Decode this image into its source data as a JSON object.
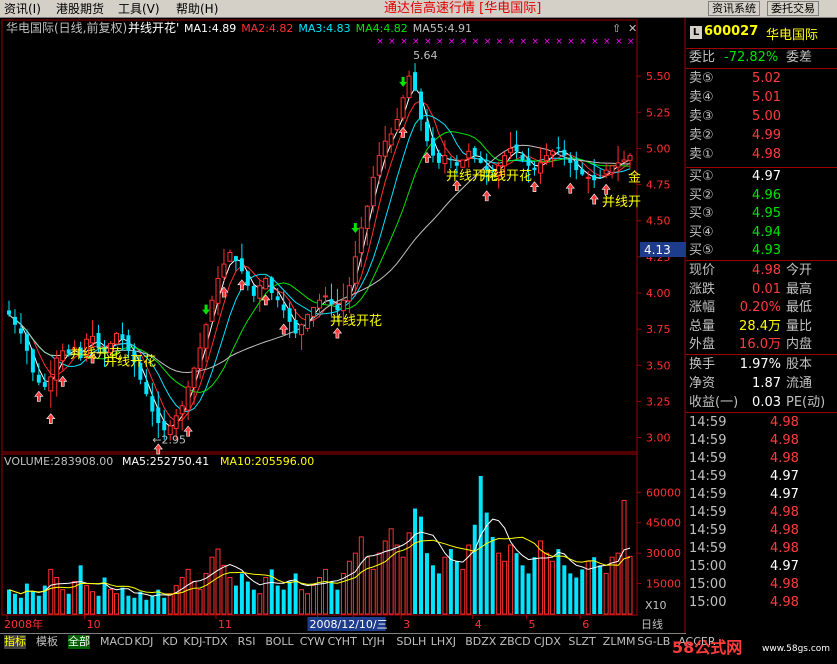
{
  "menu": {
    "items": [
      "资讯(I)",
      "港股期货",
      "工具(V)",
      "帮助(H)"
    ],
    "center_title": "通达信高速行情 [华电国际]",
    "buttons": [
      "资讯系统",
      "委托交易"
    ]
  },
  "header": {
    "stock_name": "华电国际(日线,前复权)",
    "indicator_name": "并线开花'",
    "ma_labels": [
      {
        "text": "MA1:4.89",
        "color": "#ffffff"
      },
      {
        "text": "MA2:4.82",
        "color": "#ff3030"
      },
      {
        "text": "MA3:4.83",
        "color": "#00e5ff"
      },
      {
        "text": "MA4:4.82",
        "color": "#00e400"
      },
      {
        "text": "MA55:4.91",
        "color": "#c0c0c0"
      }
    ]
  },
  "chart_data": [
    {
      "type": "candlestick",
      "title": "华电国际(日线,前复权)",
      "y_ticks": [
        5.5,
        5.25,
        5.0,
        4.75,
        4.5,
        4.25,
        4.0,
        3.75,
        3.5,
        3.25,
        3.0
      ],
      "ylim": [
        2.9,
        5.75
      ],
      "x_labels": [
        "2008年",
        "10",
        "11",
        "12",
        "2",
        "3",
        "4",
        "5",
        "6"
      ],
      "current_price_marker": "4.13",
      "annotations": [
        "5.64",
        "←2.95",
        "并线开花",
        "并线开花",
        "并线开花",
        "并线开花",
        "并线开花",
        "并线开",
        "金"
      ],
      "close_series": [
        3.85,
        3.78,
        3.72,
        3.6,
        3.45,
        3.38,
        3.35,
        3.42,
        3.55,
        3.6,
        3.58,
        3.62,
        3.55,
        3.68,
        3.7,
        3.62,
        3.58,
        3.65,
        3.72,
        3.68,
        3.6,
        3.52,
        3.4,
        3.3,
        3.18,
        3.1,
        3.05,
        3.08,
        3.15,
        3.22,
        3.35,
        3.48,
        3.62,
        3.78,
        3.95,
        4.1,
        4.2,
        4.28,
        4.22,
        4.15,
        4.05,
        3.98,
        4.05,
        4.1,
        4.0,
        3.95,
        3.88,
        3.8,
        3.72,
        3.78,
        3.85,
        3.9,
        3.95,
        3.98,
        3.92,
        3.88,
        3.95,
        4.05,
        4.25,
        4.45,
        4.6,
        4.8,
        4.95,
        5.05,
        5.1,
        5.2,
        5.35,
        5.5,
        5.4,
        5.2,
        5.05,
        4.95,
        4.9,
        4.95,
        4.92,
        4.88,
        4.92,
        4.98,
        4.95,
        4.9,
        4.85,
        4.82,
        4.88,
        4.95,
        5.0,
        4.98,
        4.92,
        4.88,
        4.85,
        4.9,
        4.95,
        4.98,
        5.0,
        4.95,
        4.9,
        4.85,
        4.82,
        4.8,
        4.78,
        4.8,
        4.85,
        4.88,
        4.9,
        4.92,
        4.95
      ]
    },
    {
      "type": "bar",
      "title": "VOLUME",
      "series": [
        {
          "name": "VOLUME:283908.00",
          "color": "#c0c0c0"
        },
        {
          "name": "MA5:252750.41",
          "color": "#ffffff"
        },
        {
          "name": "MA10:205596.00",
          "color": "#ffff00"
        }
      ],
      "y_ticks": [
        60000,
        45000,
        30000,
        15000
      ],
      "ylim": [
        0,
        70000
      ],
      "unit_label": "X10",
      "values": [
        12000,
        10000,
        8000,
        15000,
        11000,
        9000,
        14000,
        22000,
        18000,
        12000,
        10000,
        16000,
        24000,
        14000,
        11000,
        9000,
        18000,
        12000,
        10000,
        13000,
        9000,
        8000,
        11000,
        7000,
        9000,
        12000,
        8000,
        10000,
        14000,
        18000,
        22000,
        16000,
        12000,
        20000,
        28000,
        32000,
        24000,
        18000,
        14000,
        20000,
        16000,
        12000,
        10000,
        18000,
        22000,
        14000,
        12000,
        16000,
        20000,
        12000,
        10000,
        14000,
        18000,
        22000,
        16000,
        12000,
        20000,
        26000,
        30000,
        38000,
        28000,
        22000,
        30000,
        36000,
        42000,
        34000,
        28000,
        40000,
        52000,
        48000,
        30000,
        24000,
        20000,
        28000,
        32000,
        26000,
        22000,
        34000,
        44000,
        68000,
        50000,
        38000,
        30000,
        26000,
        34000,
        30000,
        24000,
        20000,
        28000,
        36000,
        30000,
        26000,
        32000,
        24000,
        20000,
        18000,
        22000,
        26000,
        28000,
        24000,
        20000,
        28000,
        30000,
        56000,
        28390
      ]
    }
  ],
  "right_panel": {
    "code": "600027",
    "name": "华电国际",
    "weibi_label": "委比",
    "weibi_value": "-72.82%",
    "weicha_label": "委差",
    "sell": [
      {
        "label": "卖⑤",
        "price": "5.02"
      },
      {
        "label": "卖④",
        "price": "5.01"
      },
      {
        "label": "卖③",
        "price": "5.00"
      },
      {
        "label": "卖②",
        "price": "4.99"
      },
      {
        "label": "卖①",
        "price": "4.98"
      }
    ],
    "buy": [
      {
        "label": "买①",
        "price": "4.97",
        "color": "white"
      },
      {
        "label": "买②",
        "price": "4.96",
        "color": "green"
      },
      {
        "label": "买③",
        "price": "4.95",
        "color": "green"
      },
      {
        "label": "买④",
        "price": "4.94",
        "color": "green"
      },
      {
        "label": "买⑤",
        "price": "4.93",
        "color": "green"
      }
    ],
    "stats": [
      {
        "label": "现价",
        "value": "4.98",
        "color": "red",
        "label2": "今开"
      },
      {
        "label": "涨跌",
        "value": "0.01",
        "color": "red",
        "label2": "最高"
      },
      {
        "label": "涨幅",
        "value": "0.20%",
        "color": "red",
        "label2": "最低"
      },
      {
        "label": "总量",
        "value": "28.4万",
        "color": "yellow",
        "label2": "量比"
      },
      {
        "label": "外盘",
        "value": "16.0万",
        "color": "red",
        "label2": "内盘"
      }
    ],
    "stats2": [
      {
        "label": "换手",
        "value": "1.97%",
        "label2": "股本"
      },
      {
        "label": "净资",
        "value": "1.87",
        "label2": "流通"
      },
      {
        "label": "收益(一)",
        "value": "0.03",
        "label2": "PE(动)"
      }
    ],
    "ticks": [
      {
        "time": "14:59",
        "price": "4.98",
        "color": "red"
      },
      {
        "time": "14:59",
        "price": "4.98",
        "color": "red"
      },
      {
        "time": "14:59",
        "price": "4.98",
        "color": "red"
      },
      {
        "time": "14:59",
        "price": "4.97",
        "color": "white"
      },
      {
        "time": "14:59",
        "price": "4.97",
        "color": "white"
      },
      {
        "time": "14:59",
        "price": "4.98",
        "color": "red"
      },
      {
        "time": "14:59",
        "price": "4.98",
        "color": "red"
      },
      {
        "time": "14:59",
        "price": "4.98",
        "color": "red"
      },
      {
        "time": "15:00",
        "price": "4.97",
        "color": "white"
      },
      {
        "time": "15:00",
        "price": "4.98",
        "color": "red"
      },
      {
        "time": "15:00",
        "price": "4.98",
        "color": "red"
      }
    ]
  },
  "bottom_tabs": [
    "指标",
    "模板",
    "全部",
    "MACD",
    "KDJ",
    "KD",
    "KDJ-TDX",
    "RSI",
    "BOLL",
    "CYW",
    "CYHT",
    "LYJH",
    "SDLH",
    "LHXJ",
    "BDZX",
    "ZBCD",
    "CJDX",
    "SLZT",
    "ZLMM",
    "SG-LB",
    "ACCER"
  ],
  "date_highlight": "2008/12/10/三",
  "period_label": "日线",
  "watermark": "58公式网",
  "watermark_url": "www.58gs.com",
  "colors": {
    "up": "#ff3030",
    "down": "#00e5ff",
    "grid": "#a00000",
    "axis_text": "#ff3030"
  }
}
